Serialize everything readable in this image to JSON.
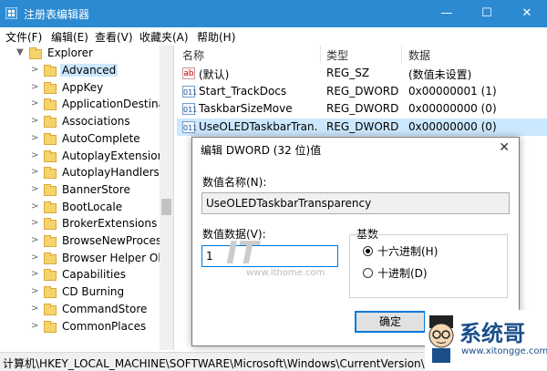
{
  "window": {
    "title": "注册表编辑器",
    "title_bar_color": "#2b8ad2",
    "minimize": "—",
    "maximize": "☐",
    "close": "✕"
  },
  "menu": [
    "文件(F)",
    "编辑(E)",
    "查看(V)",
    "收藏夹(A)",
    "帮助(H)"
  ],
  "tree": {
    "root": "Explorer",
    "selected": "Advanced",
    "items": [
      "Advanced",
      "AppKey",
      "ApplicationDestinat",
      "Associations",
      "AutoComplete",
      "AutoplayExtensions",
      "AutoplayHandlers",
      "BannerStore",
      "BootLocale",
      "BrokerExtensions",
      "BrowseNewProcess",
      "Browser Helper Ob",
      "Capabilities",
      "CD Burning",
      "CommandStore",
      "CommonPlaces"
    ]
  },
  "list": {
    "headers": {
      "name": "名称",
      "type": "类型",
      "data": "数据"
    },
    "rows": [
      {
        "icon": "ab",
        "name": "(默认)",
        "type": "REG_SZ",
        "data": "(数值未设置)"
      },
      {
        "icon": "011",
        "name": "Start_TrackDocs",
        "type": "REG_DWORD",
        "data": "0x00000001 (1)"
      },
      {
        "icon": "011",
        "name": "TaskbarSizeMove",
        "type": "REG_DWORD",
        "data": "0x00000000 (0)"
      },
      {
        "icon": "011",
        "name": "UseOLEDTaskbarTran...",
        "type": "REG_DWORD",
        "data": "0x00000000 (0)"
      }
    ]
  },
  "status": "计算机\\HKEY_LOCAL_MACHINE\\SOFTWARE\\Microsoft\\Windows\\CurrentVersion\\Exp",
  "dialog": {
    "title": "编辑 DWORD (32 位)值",
    "close": "✕",
    "value_name_label": "数值名称(N):",
    "value_name": "UseOLEDTaskbarTransparency",
    "value_data_label": "数值数据(V):",
    "value_data": "1",
    "base_label": "基数",
    "hex_label": "十六进制(H)",
    "dec_label": "十进制(D)",
    "base_selected": "hex",
    "ok": "确定",
    "cancel": "取消"
  },
  "watermark": {
    "it": "IT",
    "url": "www.ithome.com",
    "brand": "系统哥",
    "site": "www.xitongge.com"
  }
}
